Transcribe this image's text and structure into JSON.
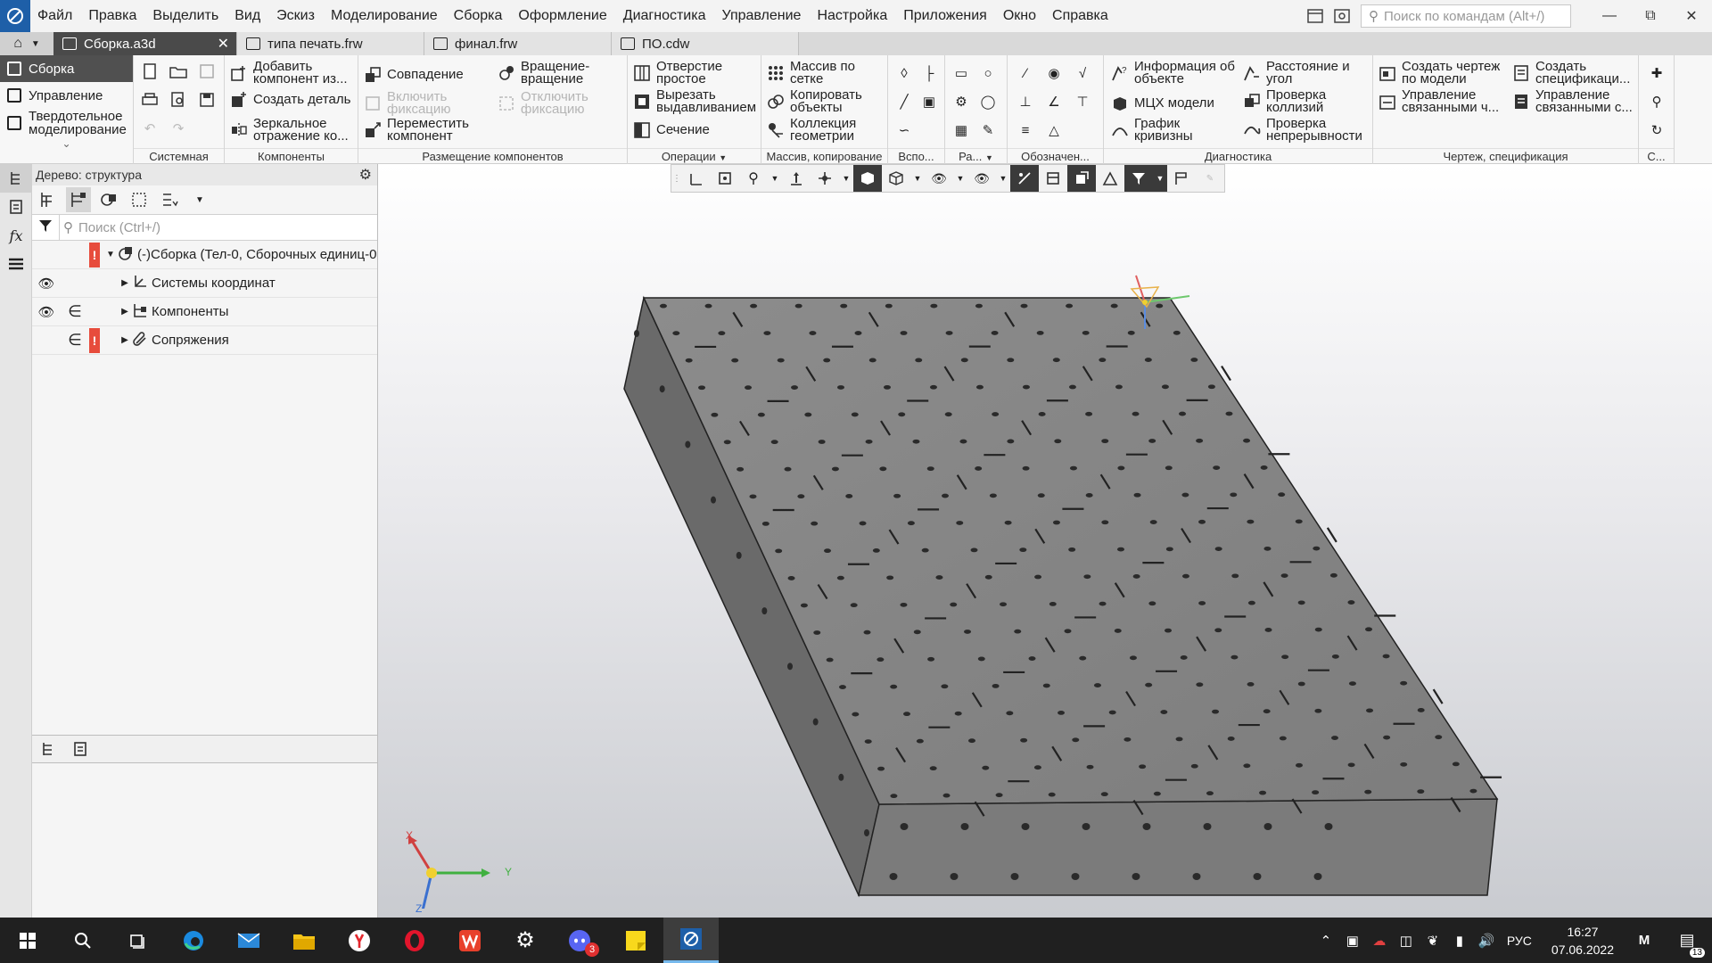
{
  "menu": {
    "items": [
      "Файл",
      "Правка",
      "Выделить",
      "Вид",
      "Эскиз",
      "Моделирование",
      "Сборка",
      "Оформление",
      "Диагностика",
      "Управление",
      "Настройка",
      "Приложения",
      "Окно",
      "Справка"
    ]
  },
  "command_search": {
    "placeholder": "Поиск по командам (Alt+/)"
  },
  "tabs": [
    {
      "label": "Сборка.a3d",
      "active": true
    },
    {
      "label": "типа печать.frw"
    },
    {
      "label": "финал.frw"
    },
    {
      "label": "ПО.cdw"
    }
  ],
  "ribbon": {
    "nav": {
      "assembly": "Сборка",
      "management": "Управление",
      "solid": "Твердотельное моделирование"
    },
    "groups": {
      "system": "Системная",
      "components": "Компоненты",
      "placement": "Размещение компонентов",
      "operations": "Операции",
      "array": "Массив, копирование",
      "aux": "Вспо...",
      "ra": "Ра...",
      "designations": "Обозначен...",
      "diagnostics": "Диагностика",
      "drawing": "Чертеж, спецификация",
      "s": "С..."
    },
    "buttons": {
      "add_component": "Добавить компонент из...",
      "create_part": "Создать деталь",
      "mirror": "Зеркальное отражение ко...",
      "coincidence": "Совпадение",
      "rotation": "Вращение-вращение",
      "enable_fix": "Включить фиксацию",
      "disable_fix": "Отключить фиксацию",
      "move_component": "Переместить компонент",
      "hole": "Отверстие простое",
      "cut_extrude": "Вырезать выдавливанием",
      "section": "Сечение",
      "grid_array": "Массив по сетке",
      "copy_objects": "Копировать объекты",
      "geom_collection": "Коллекция геометрии",
      "object_info": "Информация об объекте",
      "mass_props": "МЦХ модели",
      "curvature": "График кривизны",
      "distance_angle": "Расстояние и угол",
      "collision_check": "Проверка коллизий",
      "continuity_check": "Проверка непрерывности",
      "create_drawing": "Создать чертеж по модели",
      "manage_linked_drawings": "Управление связанными ч...",
      "create_spec": "Создать спецификаци...",
      "manage_linked_spec": "Управление связанными с..."
    }
  },
  "tree": {
    "header": "Дерево: структура",
    "search_placeholder": "Поиск (Ctrl+/)",
    "nodes": [
      {
        "label": "(-)Сборка (Тел-0, Сборочных единиц-0",
        "error": true
      },
      {
        "label": "Системы координат"
      },
      {
        "label": "Компоненты"
      },
      {
        "label": "Сопряжения",
        "error": true
      }
    ]
  },
  "axes": {
    "x": "X",
    "y": "Y",
    "z": "Z"
  },
  "taskbar": {
    "lang": "РУС",
    "time": "16:27",
    "date": "07.06.2022",
    "notif_count": "13",
    "discord_badge": "3"
  },
  "colors": {
    "accent": "#1e5fa8",
    "active_tab": "#4a4a4a",
    "error": "#e74c3c",
    "taskbar": "#202020"
  }
}
